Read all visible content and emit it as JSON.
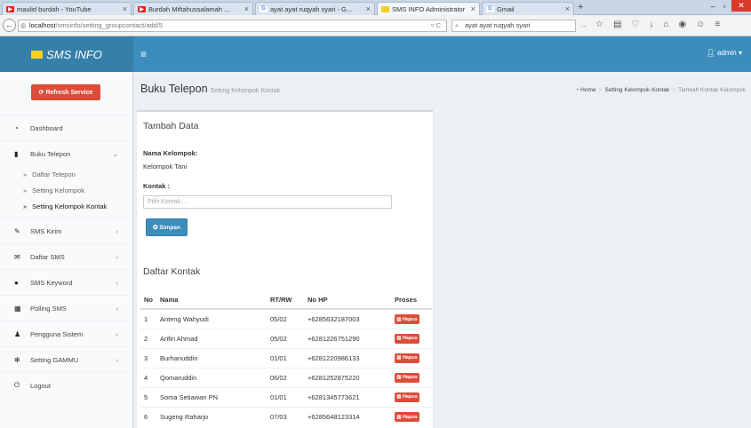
{
  "browser": {
    "tabs": [
      {
        "title": "maulid burdah - YouTube",
        "icon": "youtube-icon",
        "active": false
      },
      {
        "title": "Burdah Miftahussalamah ...",
        "icon": "youtube-icon",
        "active": false
      },
      {
        "title": "ayat ayat ruqyah syari - G...",
        "icon": "google-icon",
        "active": false
      },
      {
        "title": "SMS INFO Administrator",
        "icon": "envelope-icon",
        "active": true
      },
      {
        "title": "Gmail",
        "icon": "google-icon",
        "active": false
      }
    ],
    "url_host": "localhost",
    "url_path": "/smsinfo/setting_groupcontact/add/5",
    "search_value": "ayat ayat ruqyah syari"
  },
  "app": {
    "logo_text": "SMS INFO",
    "user_label": "admin",
    "brand_color": "#3c8dbc"
  },
  "sidebar": {
    "refresh_label": "Refresh Service",
    "items": [
      {
        "label": "Dashboard",
        "icon": "dashboard-icon",
        "has_chevron": false
      },
      {
        "label": "Buku Telepon",
        "icon": "book-icon",
        "has_chevron": true,
        "expanded": true
      },
      {
        "label": "SMS Kirim",
        "icon": "edit-icon",
        "has_chevron": true
      },
      {
        "label": "Daftar SMS",
        "icon": "envelope-icon",
        "has_chevron": true
      },
      {
        "label": "SMS Keyword",
        "icon": "comment-icon",
        "has_chevron": true
      },
      {
        "label": "Polling SMS",
        "icon": "chart-icon",
        "has_chevron": true
      },
      {
        "label": "Pengguna Sistem",
        "icon": "user-icon",
        "has_chevron": true
      },
      {
        "label": "Setting GAMMU",
        "icon": "gear-icon",
        "has_chevron": true
      },
      {
        "label": "Logout",
        "icon": "power-icon",
        "has_chevron": false
      }
    ],
    "subitems": [
      {
        "label": "Daftar Telepon",
        "active": false
      },
      {
        "label": "Setting Kelompok",
        "active": false
      },
      {
        "label": "Setting Kelompok Kontak",
        "active": true
      }
    ]
  },
  "page": {
    "title": "Buku Telepon",
    "subtitle": "Setting Kelompok Kontak",
    "breadcrumb": [
      "Home",
      "Setting Kelompok Kontak",
      "Tambah Kontak Kelompok"
    ]
  },
  "form": {
    "title": "Tambah Data",
    "group_label": "Nama Kelompok:",
    "group_value": "Kelompok Tani",
    "contact_label": "Kontak :",
    "contact_placeholder": "Pilih Kontak...",
    "submit_label": "Simpan"
  },
  "contacts": {
    "title": "Daftar Kontak",
    "columns": [
      "No",
      "Nama",
      "RT/RW",
      "No HP",
      "Proses"
    ],
    "delete_label": "Hapus",
    "rows": [
      {
        "no": "1",
        "nama": "Anteng Wahyudi",
        "rtrw": "05/02",
        "hp": "+6285632187003"
      },
      {
        "no": "2",
        "nama": "Arifin Ahmad",
        "rtrw": "05/02",
        "hp": "+6281226751290"
      },
      {
        "no": "3",
        "nama": "Burhanuddin",
        "rtrw": "01/01",
        "hp": "+6281220986133"
      },
      {
        "no": "4",
        "nama": "Qomaruddin",
        "rtrw": "06/02",
        "hp": "+6281252875220"
      },
      {
        "no": "5",
        "nama": "Soma Setiawan PN",
        "rtrw": "01/01",
        "hp": "+6281345773621"
      },
      {
        "no": "6",
        "nama": "Sugeng Raharjo",
        "rtrw": "07/03",
        "hp": "+6285648123314"
      }
    ]
  }
}
